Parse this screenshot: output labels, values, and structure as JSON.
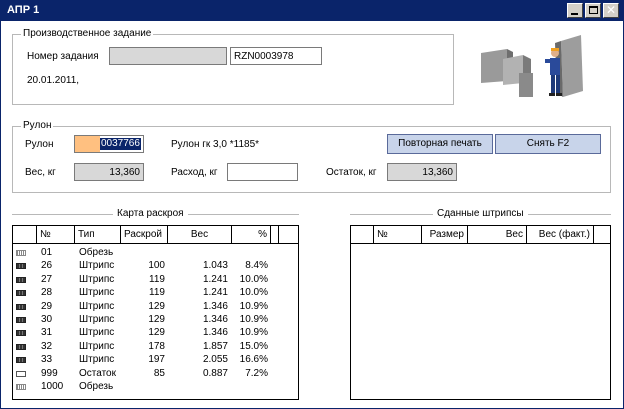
{
  "window": {
    "title": "АПР 1"
  },
  "production_task": {
    "legend": "Производственное задание",
    "order_label": "Номер задания",
    "order_value": "",
    "order_code": "RZN0003978",
    "date": "20.01.2011,"
  },
  "roll": {
    "legend": "Рулон",
    "roll_label": "Рулон",
    "roll_value": "0037766",
    "roll_desc": "Рулон гк 3,0 *1185*",
    "reprint_label": "Повторная печать",
    "remove_label": "Снять F2",
    "weight_label": "Вес, кг",
    "weight_value": "13,360",
    "consumption_label": "Расход, кг",
    "consumption_value": "",
    "remainder_label": "Остаток, кг",
    "remainder_value": "13,360"
  },
  "cut_map": {
    "title": "Карта раскроя",
    "headers": [
      "№",
      "Тип",
      "Раскрой",
      "Вес",
      "%"
    ],
    "rows": [
      {
        "swatch": "waste",
        "no": "01",
        "type": "Обрезь",
        "cut": "",
        "weight": "",
        "pct": ""
      },
      {
        "swatch": "strip",
        "no": "26",
        "type": "Штрипс",
        "cut": "100",
        "weight": "1.043",
        "pct": "8.4%"
      },
      {
        "swatch": "strip",
        "no": "27",
        "type": "Штрипс",
        "cut": "119",
        "weight": "1.241",
        "pct": "10.0%"
      },
      {
        "swatch": "strip",
        "no": "28",
        "type": "Штрипс",
        "cut": "119",
        "weight": "1.241",
        "pct": "10.0%"
      },
      {
        "swatch": "strip",
        "no": "29",
        "type": "Штрипс",
        "cut": "129",
        "weight": "1.346",
        "pct": "10.9%"
      },
      {
        "swatch": "strip",
        "no": "30",
        "type": "Штрипс",
        "cut": "129",
        "weight": "1.346",
        "pct": "10.9%"
      },
      {
        "swatch": "strip",
        "no": "31",
        "type": "Штрипс",
        "cut": "129",
        "weight": "1.346",
        "pct": "10.9%"
      },
      {
        "swatch": "strip",
        "no": "32",
        "type": "Штрипс",
        "cut": "178",
        "weight": "1.857",
        "pct": "15.0%"
      },
      {
        "swatch": "strip",
        "no": "33",
        "type": "Штрипс",
        "cut": "197",
        "weight": "2.055",
        "pct": "16.6%"
      },
      {
        "swatch": "rest",
        "no": "999",
        "type": "Остаток",
        "cut": "85",
        "weight": "0.887",
        "pct": "7.2%"
      },
      {
        "swatch": "waste",
        "no": "1000",
        "type": "Обрезь",
        "cut": "",
        "weight": "",
        "pct": ""
      }
    ]
  },
  "submitted_strips": {
    "title": "Сданные штрипсы",
    "headers": [
      "№",
      "Размер",
      "Вес",
      "Вес (факт.)"
    ]
  },
  "icons": {
    "machine": "machine-operator-icon"
  },
  "colors": {
    "titlebar": "#0a246a",
    "button": "#c8d4ea",
    "field_gray": "#d8d8d8",
    "selection": "#0a246a",
    "roll_prefix": "#ffc080"
  }
}
